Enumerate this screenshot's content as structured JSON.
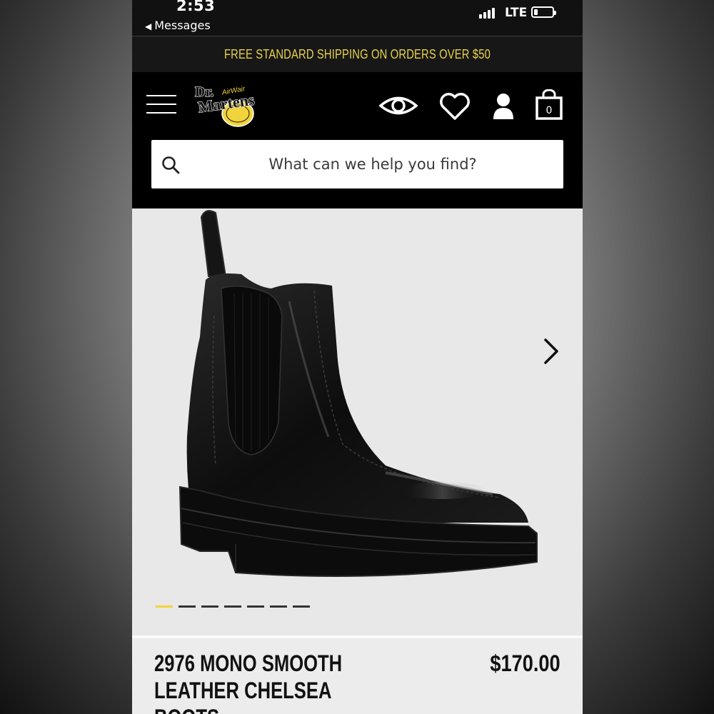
{
  "status_bar": {
    "time": "2:53",
    "back_label": "Messages",
    "network": "LTE"
  },
  "promo": {
    "text": "FREE STANDARD SHIPPING ON ORDERS OVER $50"
  },
  "header": {
    "logo_text": "Dr. Martens",
    "logo_sub": "AirWair",
    "cart_count": "0"
  },
  "search": {
    "placeholder": "What can we help you find?"
  },
  "gallery": {
    "slide_count": 7,
    "active_index": 0
  },
  "product": {
    "name_line1": "2976 MONO SMOOTH",
    "name_line2": "LEATHER CHELSEA BOOTS",
    "price": "$170.00"
  },
  "colors": {
    "promo_text": "#e8d24a",
    "active_dot": "#f1d33b",
    "header_bg": "#000000"
  }
}
